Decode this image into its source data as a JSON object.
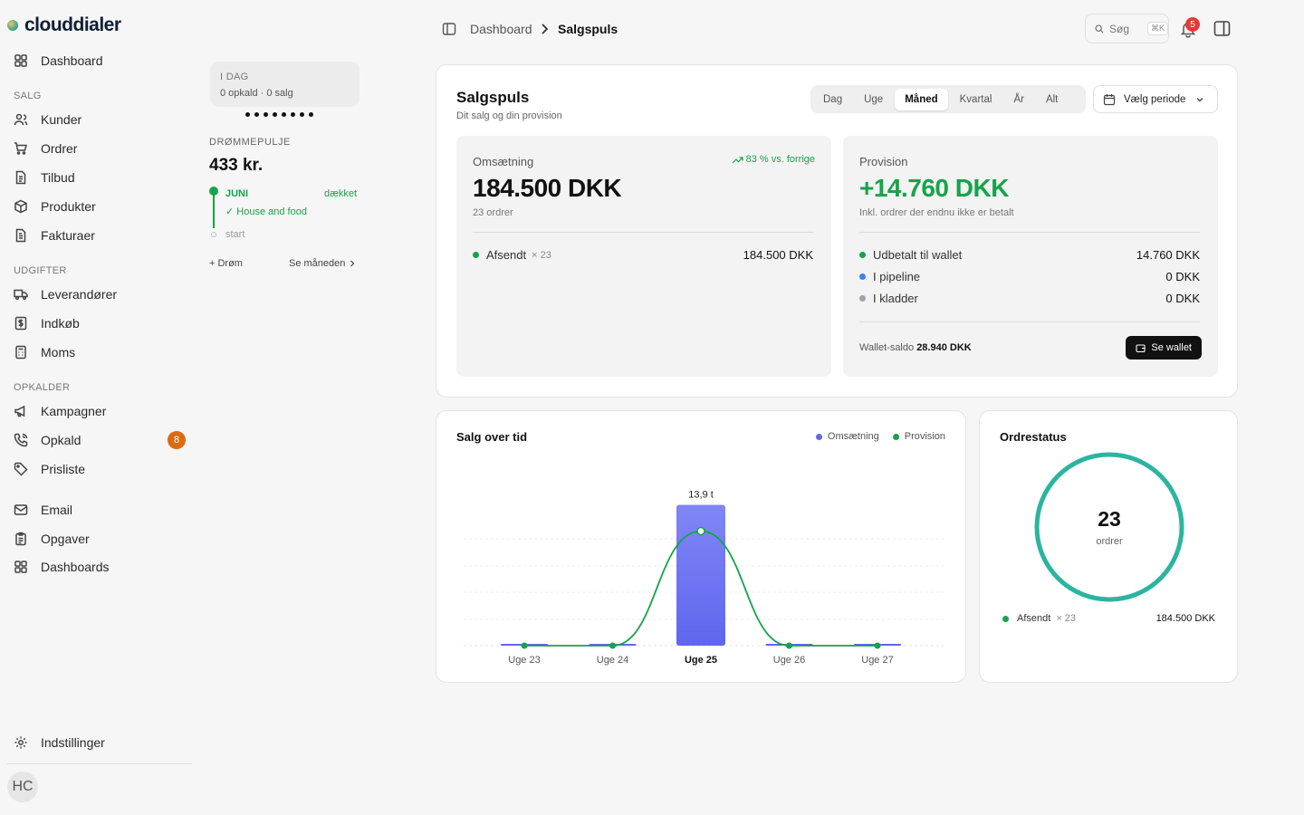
{
  "app": {
    "name": "clouddialer"
  },
  "sidebar": {
    "top": {
      "label": "Dashboard",
      "icon": "grid-icon"
    },
    "sections": [
      {
        "title": "SALG",
        "items": [
          {
            "label": "Kunder",
            "icon": "users-icon"
          },
          {
            "label": "Ordrer",
            "icon": "cart-icon"
          },
          {
            "label": "Tilbud",
            "icon": "document-icon"
          },
          {
            "label": "Produkter",
            "icon": "box-icon"
          },
          {
            "label": "Fakturaer",
            "icon": "invoice-icon"
          }
        ]
      },
      {
        "title": "UDGIFTER",
        "items": [
          {
            "label": "Leverandører",
            "icon": "truck-icon"
          },
          {
            "label": "Indkøb",
            "icon": "dollar-icon"
          },
          {
            "label": "Moms",
            "icon": "calculator-icon"
          }
        ]
      },
      {
        "title": "OPKALDER",
        "items": [
          {
            "label": "Kampagner",
            "icon": "megaphone-icon"
          },
          {
            "label": "Opkald",
            "icon": "phone-icon",
            "badge": "8"
          },
          {
            "label": "Prisliste",
            "icon": "tag-icon"
          }
        ]
      }
    ],
    "extra": [
      {
        "label": "Email",
        "icon": "mail-icon"
      },
      {
        "label": "Opgaver",
        "icon": "clipboard-icon"
      },
      {
        "label": "Dashboards",
        "icon": "grid-icon"
      }
    ],
    "settings": {
      "label": "Indstillinger",
      "icon": "gear-icon"
    },
    "avatar": "HC"
  },
  "today": {
    "title": "I DAG",
    "summary": "0 opkald · 0 salg"
  },
  "dream": {
    "title": "DRØMMEPULJE",
    "value": "433 kr.",
    "month": "JUNI",
    "status": "dækket",
    "item": "✓ House and food",
    "start": "start",
    "add_label": "+ Drøm",
    "month_link": "Se måneden"
  },
  "topbar": {
    "crumb_root": "Dashboard",
    "crumb_current": "Salgspuls",
    "search_placeholder": "Søg",
    "search_shortcut": "⌘K",
    "notifications": "5"
  },
  "salgspuls": {
    "title": "Salgspuls",
    "subtitle": "Dit salg og din provision",
    "periods": [
      "Dag",
      "Uge",
      "Måned",
      "Kvartal",
      "År",
      "Alt"
    ],
    "active_period": 2,
    "period_button": "Vælg periode",
    "revenue": {
      "label": "Omsætning",
      "trend": "83 % vs. forrige",
      "value": "184.500 DKK",
      "orders": "23 ordrer",
      "rows": [
        {
          "label": "Afsendt",
          "count": "× 23",
          "amount": "184.500 DKK",
          "color": "#16a34a"
        }
      ]
    },
    "commission": {
      "label": "Provision",
      "value": "+14.760 DKK",
      "note": "Inkl. ordrer der endnu ikke er betalt",
      "rows": [
        {
          "label": "Udbetalt til wallet",
          "amount": "14.760 DKK",
          "color": "#16a34a"
        },
        {
          "label": "I pipeline",
          "amount": "0 DKK",
          "color": "#3b82f6"
        },
        {
          "label": "I kladder",
          "amount": "0 DKK",
          "color": "#9ca3af"
        }
      ],
      "wallet_label": "Wallet-saldo",
      "wallet_value": "28.940 DKK",
      "wallet_button": "Se wallet"
    }
  },
  "chart_data": {
    "type": "bar",
    "title": "Salg over tid",
    "categories": [
      "Uge 23",
      "Uge 24",
      "Uge 25",
      "Uge 26",
      "Uge 27"
    ],
    "highlight_category": "Uge 25",
    "series": [
      {
        "name": "Omsætning",
        "values": [
          0,
          0,
          13.9,
          0,
          0
        ],
        "color": "#6366f1"
      },
      {
        "name": "Provision",
        "values": [
          0,
          0,
          13.9,
          0,
          0
        ],
        "color": "#16a34a"
      }
    ],
    "data_labels": [
      "",
      "",
      "13,9 t",
      "",
      ""
    ],
    "ylim": [
      0,
      16
    ],
    "grid": true,
    "legend": "top-right"
  },
  "order_status": {
    "title": "Ordrestatus",
    "total": "23",
    "total_label": "ordrer",
    "ring_color": "#2bb5a0",
    "rows": [
      {
        "label": "Afsendt",
        "count": "× 23",
        "amount": "184.500 DKK",
        "color": "#16a34a"
      }
    ]
  }
}
